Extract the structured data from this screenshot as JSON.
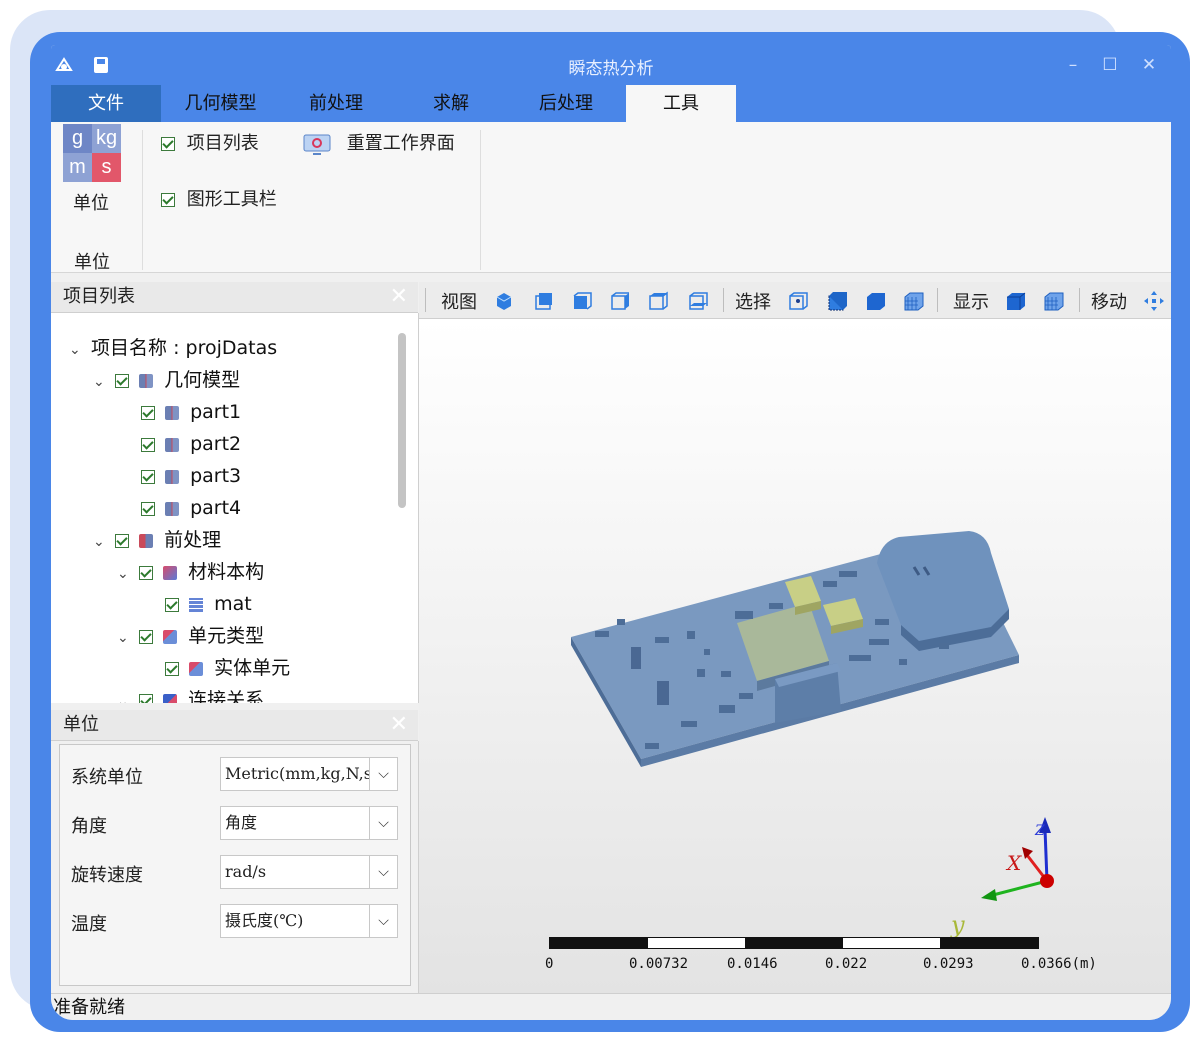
{
  "app": {
    "title": "瞬态热分析"
  },
  "menu": {
    "tabs": [
      "文件",
      "几何模型",
      "前处理",
      "求解",
      "后处理",
      "工具"
    ],
    "active": "工具"
  },
  "ribbon": {
    "unit_button_label": "单位",
    "unit_icon_letters": [
      "g",
      "kg",
      "m",
      "s"
    ],
    "group_label": "单位",
    "project_list_check": "项目列表",
    "graphics_toolbar_check": "图形工具栏",
    "reset_workspace": "重置工作界面"
  },
  "project_panel": {
    "title": "项目列表",
    "tree": [
      {
        "label": "项目名称 : projDatas",
        "level": 0,
        "expanded": true,
        "checkbox": false,
        "icon": "none"
      },
      {
        "label": "几何模型",
        "level": 1,
        "expanded": true,
        "checkbox": true,
        "icon": "geometry-icon"
      },
      {
        "label": "part1",
        "level": 2,
        "checkbox": true,
        "icon": "part-icon"
      },
      {
        "label": "part2",
        "level": 2,
        "checkbox": true,
        "icon": "part-icon"
      },
      {
        "label": "part3",
        "level": 2,
        "checkbox": true,
        "icon": "part-icon"
      },
      {
        "label": "part4",
        "level": 2,
        "checkbox": true,
        "icon": "part-icon"
      },
      {
        "label": "前处理",
        "level": 1,
        "expanded": true,
        "checkbox": true,
        "icon": "preprocess-icon"
      },
      {
        "label": "材料本构",
        "level": 2,
        "expanded": true,
        "checkbox": true,
        "icon": "material-icon"
      },
      {
        "label": "mat",
        "level": 3,
        "checkbox": true,
        "icon": "grid-icon"
      },
      {
        "label": "单元类型",
        "level": 2,
        "expanded": true,
        "checkbox": true,
        "icon": "element-type-icon"
      },
      {
        "label": "实体单元",
        "level": 3,
        "checkbox": true,
        "icon": "solid-element-icon"
      },
      {
        "label": "连接关系",
        "level": 2,
        "expanded": true,
        "checkbox": true,
        "icon": "connection-icon"
      }
    ]
  },
  "unit_panel": {
    "title": "单位",
    "rows": [
      {
        "label": "系统单位",
        "value": "Metric(mm,kg,N,s)"
      },
      {
        "label": "角度",
        "value": "角度"
      },
      {
        "label": "旋转速度",
        "value": "rad/s"
      },
      {
        "label": "温度",
        "value": "摄氏度(℃)"
      }
    ]
  },
  "graphics_toolbar": {
    "view_label": "视图",
    "select_label": "选择",
    "display_label": "显示",
    "move_label": "移动"
  },
  "viewport": {
    "axis_labels": {
      "x": "X",
      "y": "y",
      "z": "Z"
    },
    "scale_ticks": [
      "0",
      "0.00732",
      "0.0146",
      "0.022",
      "0.0293",
      "0.0366(m)"
    ]
  },
  "status": {
    "text": "准备就绪"
  },
  "colors": {
    "accent": "#4a86e8",
    "file_tab": "#2f6ebe",
    "model": "#6f8fb8",
    "chip": "#c9cf8a"
  }
}
